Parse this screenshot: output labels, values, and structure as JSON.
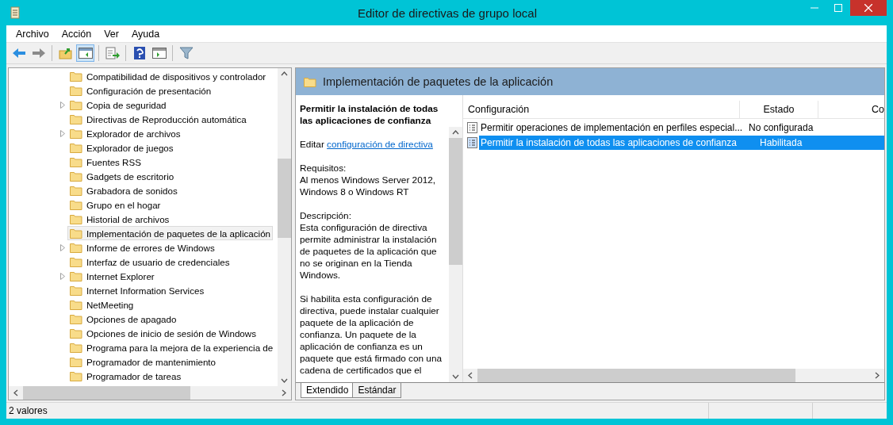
{
  "window": {
    "title": "Editor de directivas de grupo local"
  },
  "menu": [
    "Archivo",
    "Acción",
    "Ver",
    "Ayuda"
  ],
  "tree": {
    "items": [
      {
        "label": "Compatibilidad de dispositivos y controlador",
        "expandable": false,
        "selected": false
      },
      {
        "label": "Configuración de presentación",
        "expandable": false,
        "selected": false
      },
      {
        "label": "Copia de seguridad",
        "expandable": true,
        "selected": false
      },
      {
        "label": "Directivas de Reproducción automática",
        "expandable": false,
        "selected": false
      },
      {
        "label": "Explorador de archivos",
        "expandable": true,
        "selected": false
      },
      {
        "label": "Explorador de juegos",
        "expandable": false,
        "selected": false
      },
      {
        "label": "Fuentes RSS",
        "expandable": false,
        "selected": false
      },
      {
        "label": "Gadgets de escritorio",
        "expandable": false,
        "selected": false
      },
      {
        "label": "Grabadora de sonidos",
        "expandable": false,
        "selected": false
      },
      {
        "label": "Grupo en el hogar",
        "expandable": false,
        "selected": false
      },
      {
        "label": "Historial de archivos",
        "expandable": false,
        "selected": false
      },
      {
        "label": "Implementación de paquetes de la aplicación",
        "expandable": false,
        "selected": true
      },
      {
        "label": "Informe de errores de Windows",
        "expandable": true,
        "selected": false
      },
      {
        "label": "Interfaz de usuario de credenciales",
        "expandable": false,
        "selected": false
      },
      {
        "label": "Internet Explorer",
        "expandable": true,
        "selected": false
      },
      {
        "label": "Internet Information Services",
        "expandable": false,
        "selected": false
      },
      {
        "label": "NetMeeting",
        "expandable": false,
        "selected": false
      },
      {
        "label": "Opciones de apagado",
        "expandable": false,
        "selected": false
      },
      {
        "label": "Opciones de inicio de sesión de Windows",
        "expandable": false,
        "selected": false
      },
      {
        "label": "Programa para la mejora de la experiencia de",
        "expandable": false,
        "selected": false
      },
      {
        "label": "Programador de mantenimiento",
        "expandable": false,
        "selected": false
      },
      {
        "label": "Programador de tareas",
        "expandable": false,
        "selected": false
      }
    ]
  },
  "details": {
    "header": "Implementación de paquetes de la aplicación",
    "title": "Permitir la instalación de todas las aplicaciones de confianza",
    "edit_prefix": "Editar",
    "edit_link": "configuración de directiva",
    "paragraphs": [
      [
        "Requisitos:",
        "Al menos Windows Server 2012,",
        "Windows 8 o Windows RT"
      ],
      [
        "Descripción:",
        "Esta configuración de directiva permite administrar la instalación de paquetes de la aplicación que no se originan en la Tienda Windows."
      ],
      [
        "Si habilita esta configuración de directiva, puede instalar cualquier paquete de la aplicación de confianza. Un paquete de la aplicación de confianza es un paquete que está firmado con una cadena de certificados que el"
      ]
    ]
  },
  "tabs": [
    {
      "label": "Extendido",
      "selected": true
    },
    {
      "label": "Estándar",
      "selected": false
    }
  ],
  "table": {
    "columns": [
      "Configuración",
      "Estado",
      "Co"
    ],
    "rows": [
      {
        "setting": "Permitir operaciones de implementación en perfiles especial...",
        "state": "No configurada",
        "selected": false
      },
      {
        "setting": "Permitir la instalación de todas las aplicaciones de confianza",
        "state": "Habilitada",
        "selected": true
      }
    ]
  },
  "status_bar": {
    "text": "2 valores"
  }
}
